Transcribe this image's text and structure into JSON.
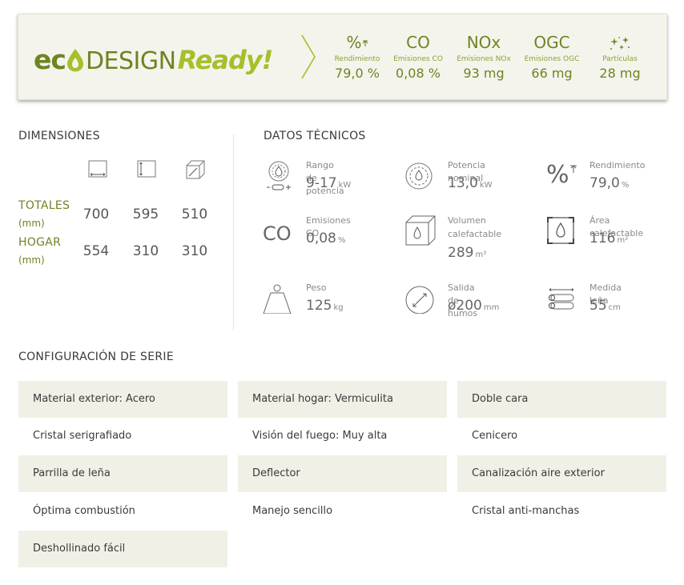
{
  "eco": {
    "word_eco": "ec",
    "word_design": "DESIGN",
    "word_ready": "Ready!",
    "metrics": [
      {
        "symbol": "%",
        "label": "Rendimiento",
        "value": "79,0 %"
      },
      {
        "symbol": "CO",
        "label": "Emisiones CO",
        "value": "0,08 %"
      },
      {
        "symbol": "NOx",
        "label": "Emisiones NOx",
        "value": "93 mg"
      },
      {
        "symbol": "OGC",
        "label": "Emisiones OGC",
        "value": "66 mg"
      },
      {
        "symbol": "",
        "label": "Partículas",
        "value": "28 mg"
      }
    ]
  },
  "dimensions": {
    "title": "DIMENSIONES",
    "rows": [
      {
        "label": "TOTALES",
        "unit": "(mm)",
        "values": [
          "700",
          "595",
          "510"
        ]
      },
      {
        "label": "HOGAR",
        "unit": "(mm)",
        "values": [
          "554",
          "310",
          "310"
        ]
      }
    ]
  },
  "tech": {
    "title": "DATOS TÉCNICOS",
    "items": [
      {
        "label": "Rango de potencia",
        "value": "9-17",
        "unit": "kW"
      },
      {
        "label": "Potencia nominal",
        "value": "13,0",
        "unit": "kW"
      },
      {
        "label": "Rendimiento",
        "value": "79,0",
        "unit": "%"
      },
      {
        "label": "Emisiones CO",
        "value": "0,08",
        "unit": "%",
        "icon_text": "CO"
      },
      {
        "label_line1": "Volumen",
        "label_line2": "calefactable",
        "value": "289",
        "unit": "m³"
      },
      {
        "label": "Área calefactable",
        "value": "116",
        "unit": "m²"
      },
      {
        "label": "Peso",
        "value": "125",
        "unit": "kg"
      },
      {
        "label": "Salida de humos",
        "value": "ø200",
        "unit": "mm"
      },
      {
        "label": "Medida leña",
        "value": "55",
        "unit": "cm"
      }
    ]
  },
  "config": {
    "title": "CONFIGURACIÓN DE SERIE",
    "items": [
      "Material exterior: Acero",
      "Material hogar: Vermiculita",
      "Doble cara",
      "Cristal serigrafiado",
      "Visión del fuego: Muy alta",
      "Cenicero",
      "Parrilla de leña",
      "Deflector",
      "Canalización aire exterior",
      "Óptima combustión",
      "Manejo sencillo",
      "Cristal anti-manchas",
      "Deshollinado fácil"
    ]
  },
  "colors": {
    "brand_green": "#6e8423",
    "light_green": "#a6bf2b",
    "cell_shade": "#f0f0e6"
  }
}
